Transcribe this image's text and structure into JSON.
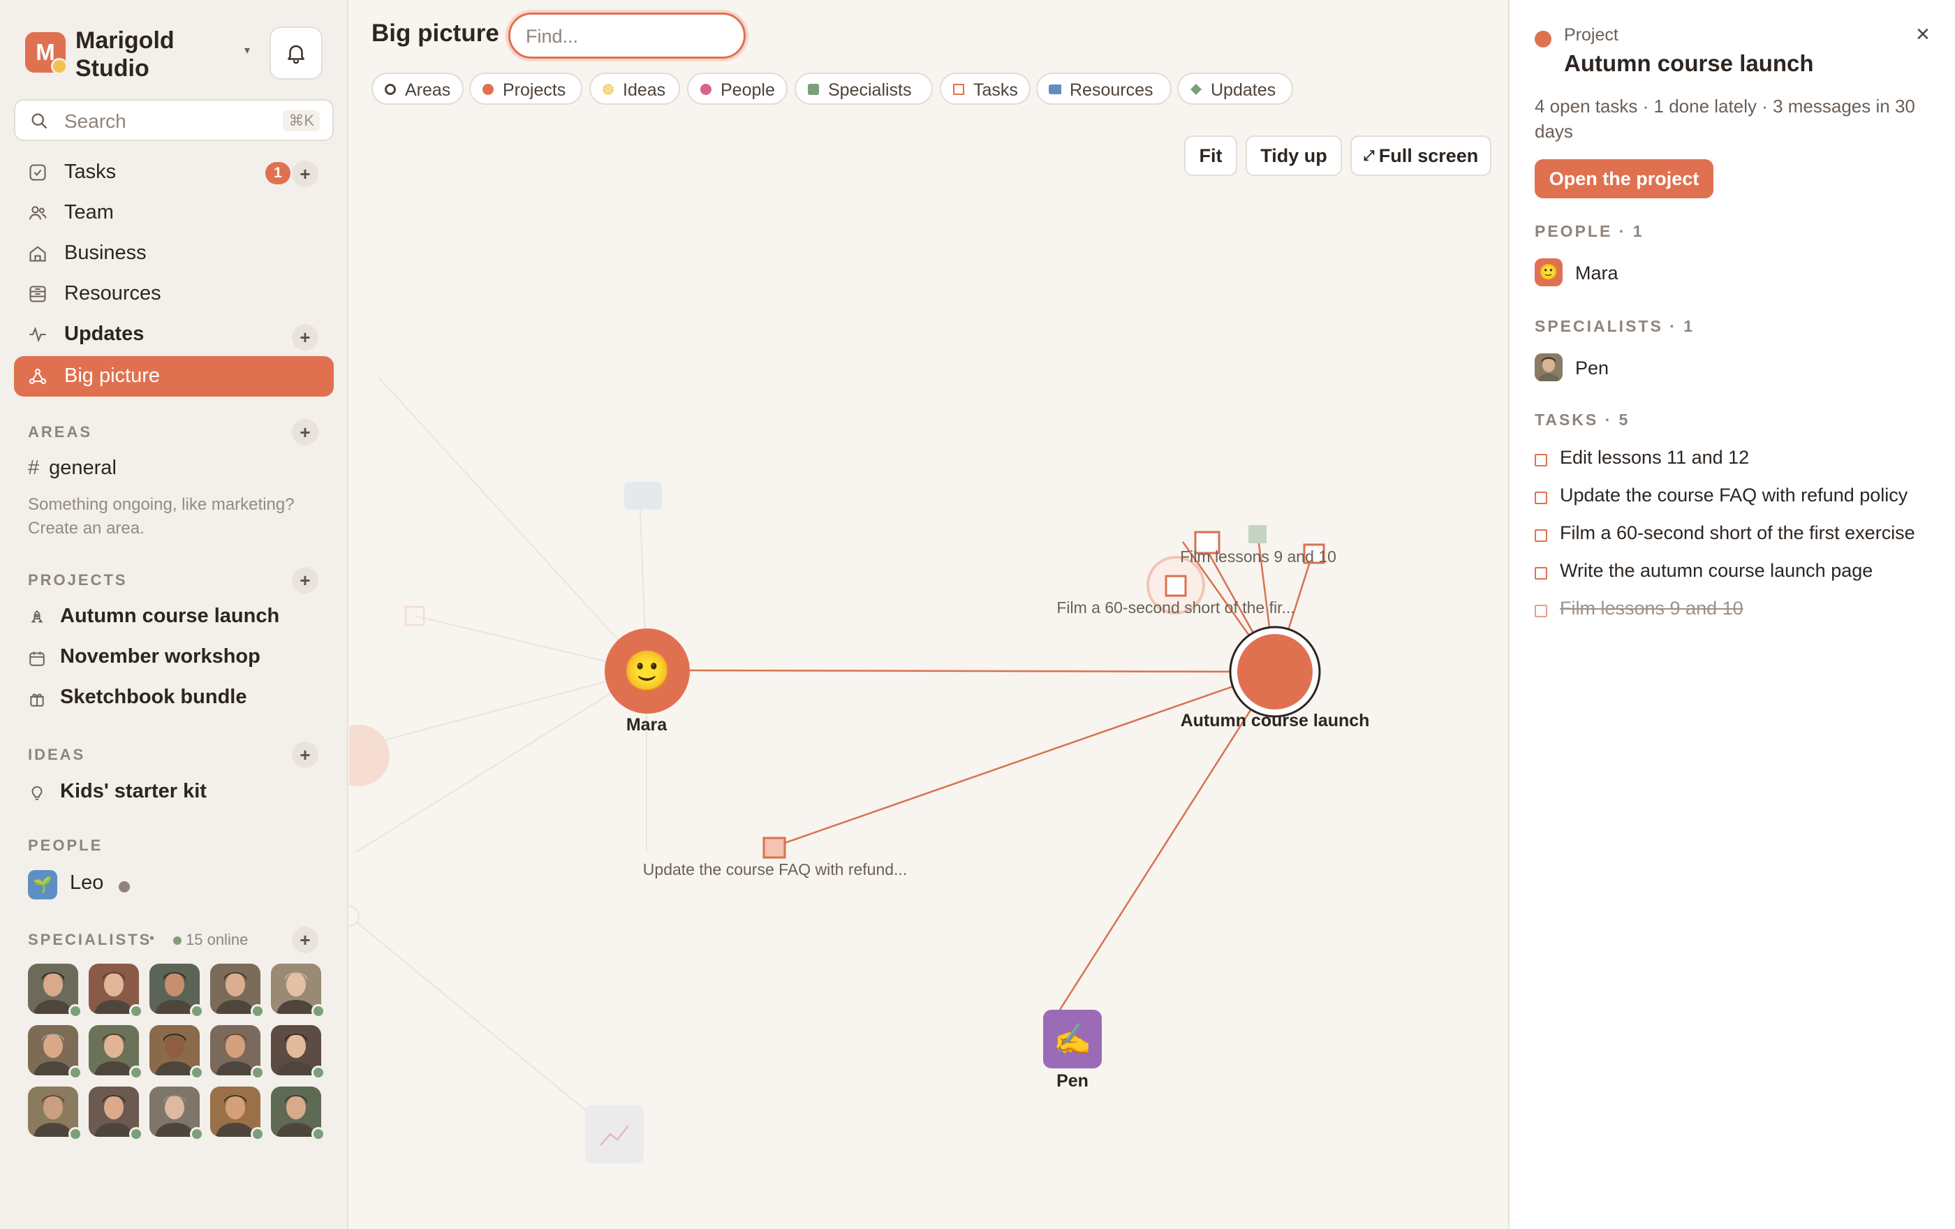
{
  "brand": {
    "initial": "M",
    "name": "Marigold Studio"
  },
  "search": {
    "placeholder": "Search",
    "shortcut": "⌘K"
  },
  "nav": [
    {
      "label": "Tasks",
      "icon": "checkbox-icon",
      "badge": "1"
    },
    {
      "label": "Team",
      "icon": "people-icon"
    },
    {
      "label": "Business",
      "icon": "home-icon"
    },
    {
      "label": "Resources",
      "icon": "archive-icon"
    },
    {
      "label": "Updates",
      "icon": "pulse-icon"
    },
    {
      "label": "Big picture",
      "icon": "graph-icon"
    }
  ],
  "areas": {
    "heading": "AREAS",
    "items": [
      "general"
    ],
    "hint": "Something ongoing, like marketing? Create an area."
  },
  "projects": {
    "heading": "PROJECTS",
    "items": [
      {
        "label": "Autumn course launch",
        "icon": "rocket-icon"
      },
      {
        "label": "November workshop",
        "icon": "calendar-icon"
      },
      {
        "label": "Sketchbook bundle",
        "icon": "gift-icon"
      }
    ]
  },
  "ideas": {
    "heading": "IDEAS",
    "items": [
      {
        "label": "Kids' starter kit",
        "icon": "bulb-icon"
      }
    ]
  },
  "people": {
    "heading": "PEOPLE",
    "items": [
      {
        "label": "Leo",
        "avatar": "🌱"
      }
    ]
  },
  "specialists": {
    "heading": "SPECIALISTS",
    "separator": "•",
    "online": "15 online",
    "count_shown": 15
  },
  "main": {
    "title": "Big picture",
    "find_placeholder": "Find...",
    "filters": [
      "Areas",
      "Projects",
      "Ideas",
      "People",
      "Specialists",
      "Tasks",
      "Resources",
      "Updates"
    ],
    "tools": {
      "fit": "Fit",
      "tidy": "Tidy up",
      "full": "Full screen",
      "full_icon": "⤢"
    }
  },
  "graph": {
    "center": "Autumn course launch",
    "person": {
      "name": "Mara",
      "emoji": "🙂"
    },
    "specialist": {
      "name": "Pen",
      "emoji": "✍️"
    },
    "tasks": [
      "Film lessons 9 and 10",
      "Film a 60-second short of the fir...",
      "Update the course FAQ with refund..."
    ]
  },
  "panel": {
    "kind": "Project",
    "title": "Autumn course launch",
    "close": "×",
    "meta": "4 open tasks · 1 done lately · 3 messages in 30 days",
    "open_button": "Open the project",
    "people_heading": "PEOPLE · 1",
    "people": [
      {
        "name": "Mara",
        "emoji": "🙂"
      }
    ],
    "specialists_heading": "SPECIALISTS · 1",
    "specialists": [
      {
        "name": "Pen"
      }
    ],
    "tasks_heading": "TASKS · 5",
    "tasks": [
      {
        "label": "Edit lessons 11 and 12",
        "done": false
      },
      {
        "label": "Update the course FAQ with refund policy",
        "done": false
      },
      {
        "label": "Film a 60-second short of the first exercise",
        "done": false
      },
      {
        "label": "Write the autumn course launch page",
        "done": false
      },
      {
        "label": "Film lessons 9 and 10",
        "done": true
      }
    ]
  },
  "colors": {
    "accent": "#e07150",
    "specialist_green": "#7c9f7a",
    "resource_blue": "#5e8fc2",
    "pen_purple": "#9b6bb8"
  }
}
